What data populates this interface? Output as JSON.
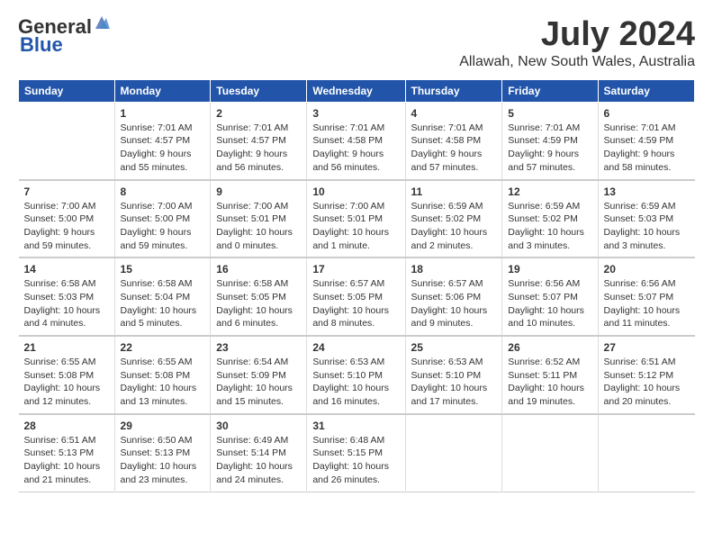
{
  "header": {
    "logo_general": "General",
    "logo_blue": "Blue",
    "month": "July 2024",
    "location": "Allawah, New South Wales, Australia"
  },
  "days_of_week": [
    "Sunday",
    "Monday",
    "Tuesday",
    "Wednesday",
    "Thursday",
    "Friday",
    "Saturday"
  ],
  "weeks": [
    [
      {
        "day": "",
        "info": ""
      },
      {
        "day": "1",
        "info": "Sunrise: 7:01 AM\nSunset: 4:57 PM\nDaylight: 9 hours\nand 55 minutes."
      },
      {
        "day": "2",
        "info": "Sunrise: 7:01 AM\nSunset: 4:57 PM\nDaylight: 9 hours\nand 56 minutes."
      },
      {
        "day": "3",
        "info": "Sunrise: 7:01 AM\nSunset: 4:58 PM\nDaylight: 9 hours\nand 56 minutes."
      },
      {
        "day": "4",
        "info": "Sunrise: 7:01 AM\nSunset: 4:58 PM\nDaylight: 9 hours\nand 57 minutes."
      },
      {
        "day": "5",
        "info": "Sunrise: 7:01 AM\nSunset: 4:59 PM\nDaylight: 9 hours\nand 57 minutes."
      },
      {
        "day": "6",
        "info": "Sunrise: 7:01 AM\nSunset: 4:59 PM\nDaylight: 9 hours\nand 58 minutes."
      }
    ],
    [
      {
        "day": "7",
        "info": "Sunrise: 7:00 AM\nSunset: 5:00 PM\nDaylight: 9 hours\nand 59 minutes."
      },
      {
        "day": "8",
        "info": "Sunrise: 7:00 AM\nSunset: 5:00 PM\nDaylight: 9 hours\nand 59 minutes."
      },
      {
        "day": "9",
        "info": "Sunrise: 7:00 AM\nSunset: 5:01 PM\nDaylight: 10 hours\nand 0 minutes."
      },
      {
        "day": "10",
        "info": "Sunrise: 7:00 AM\nSunset: 5:01 PM\nDaylight: 10 hours\nand 1 minute."
      },
      {
        "day": "11",
        "info": "Sunrise: 6:59 AM\nSunset: 5:02 PM\nDaylight: 10 hours\nand 2 minutes."
      },
      {
        "day": "12",
        "info": "Sunrise: 6:59 AM\nSunset: 5:02 PM\nDaylight: 10 hours\nand 3 minutes."
      },
      {
        "day": "13",
        "info": "Sunrise: 6:59 AM\nSunset: 5:03 PM\nDaylight: 10 hours\nand 3 minutes."
      }
    ],
    [
      {
        "day": "14",
        "info": "Sunrise: 6:58 AM\nSunset: 5:03 PM\nDaylight: 10 hours\nand 4 minutes."
      },
      {
        "day": "15",
        "info": "Sunrise: 6:58 AM\nSunset: 5:04 PM\nDaylight: 10 hours\nand 5 minutes."
      },
      {
        "day": "16",
        "info": "Sunrise: 6:58 AM\nSunset: 5:05 PM\nDaylight: 10 hours\nand 6 minutes."
      },
      {
        "day": "17",
        "info": "Sunrise: 6:57 AM\nSunset: 5:05 PM\nDaylight: 10 hours\nand 8 minutes."
      },
      {
        "day": "18",
        "info": "Sunrise: 6:57 AM\nSunset: 5:06 PM\nDaylight: 10 hours\nand 9 minutes."
      },
      {
        "day": "19",
        "info": "Sunrise: 6:56 AM\nSunset: 5:07 PM\nDaylight: 10 hours\nand 10 minutes."
      },
      {
        "day": "20",
        "info": "Sunrise: 6:56 AM\nSunset: 5:07 PM\nDaylight: 10 hours\nand 11 minutes."
      }
    ],
    [
      {
        "day": "21",
        "info": "Sunrise: 6:55 AM\nSunset: 5:08 PM\nDaylight: 10 hours\nand 12 minutes."
      },
      {
        "day": "22",
        "info": "Sunrise: 6:55 AM\nSunset: 5:08 PM\nDaylight: 10 hours\nand 13 minutes."
      },
      {
        "day": "23",
        "info": "Sunrise: 6:54 AM\nSunset: 5:09 PM\nDaylight: 10 hours\nand 15 minutes."
      },
      {
        "day": "24",
        "info": "Sunrise: 6:53 AM\nSunset: 5:10 PM\nDaylight: 10 hours\nand 16 minutes."
      },
      {
        "day": "25",
        "info": "Sunrise: 6:53 AM\nSunset: 5:10 PM\nDaylight: 10 hours\nand 17 minutes."
      },
      {
        "day": "26",
        "info": "Sunrise: 6:52 AM\nSunset: 5:11 PM\nDaylight: 10 hours\nand 19 minutes."
      },
      {
        "day": "27",
        "info": "Sunrise: 6:51 AM\nSunset: 5:12 PM\nDaylight: 10 hours\nand 20 minutes."
      }
    ],
    [
      {
        "day": "28",
        "info": "Sunrise: 6:51 AM\nSunset: 5:13 PM\nDaylight: 10 hours\nand 21 minutes."
      },
      {
        "day": "29",
        "info": "Sunrise: 6:50 AM\nSunset: 5:13 PM\nDaylight: 10 hours\nand 23 minutes."
      },
      {
        "day": "30",
        "info": "Sunrise: 6:49 AM\nSunset: 5:14 PM\nDaylight: 10 hours\nand 24 minutes."
      },
      {
        "day": "31",
        "info": "Sunrise: 6:48 AM\nSunset: 5:15 PM\nDaylight: 10 hours\nand 26 minutes."
      },
      {
        "day": "",
        "info": ""
      },
      {
        "day": "",
        "info": ""
      },
      {
        "day": "",
        "info": ""
      }
    ]
  ]
}
